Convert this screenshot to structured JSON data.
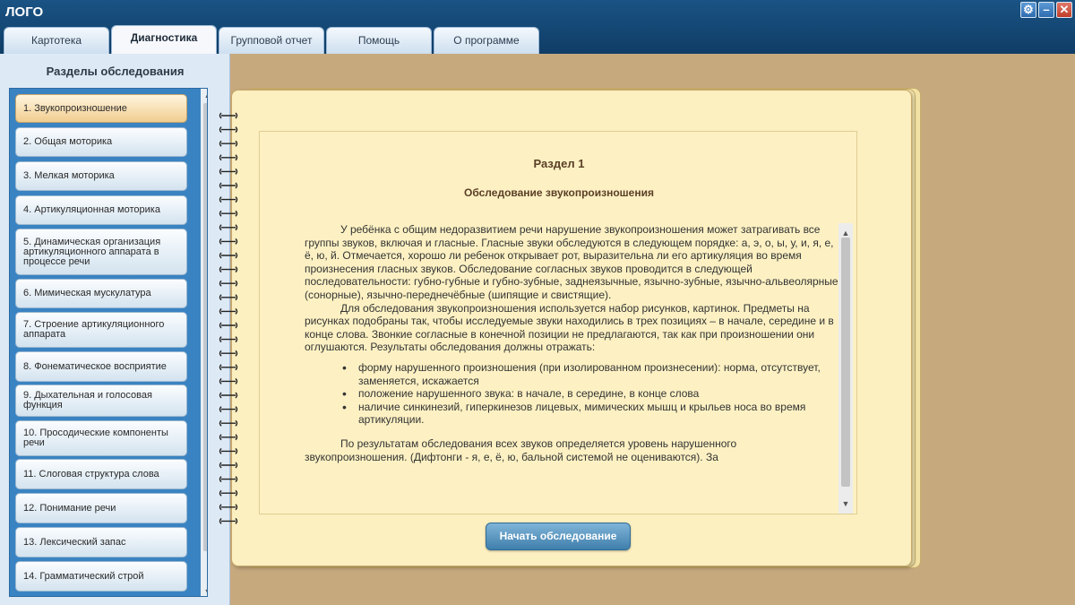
{
  "app": {
    "title": "ЛОГО"
  },
  "window_controls": {
    "settings": "⚙",
    "minimize": "–",
    "close": "✕"
  },
  "tabs": [
    {
      "label": "Картотека",
      "active": false
    },
    {
      "label": "Диагностика",
      "active": true
    },
    {
      "label": "Групповой отчет",
      "active": false
    },
    {
      "label": "Помощь",
      "active": false
    },
    {
      "label": "О программе",
      "active": false
    }
  ],
  "sidebar": {
    "title": "Разделы обследования",
    "items": [
      {
        "label": "1. Звукопроизношение",
        "active": true
      },
      {
        "label": "2. Общая моторика",
        "active": false
      },
      {
        "label": "3. Мелкая моторика",
        "active": false
      },
      {
        "label": "4. Артикуляционная моторика",
        "active": false
      },
      {
        "label": "5. Динамическая организация артикуляционного аппарата в процессе речи",
        "active": false
      },
      {
        "label": "6. Мимическая мускулатура",
        "active": false
      },
      {
        "label": "7. Строение артикуляционного аппарата",
        "active": false
      },
      {
        "label": "8. Фонематическое восприятие",
        "active": false
      },
      {
        "label": "9. Дыхательная и голосовая функция",
        "active": false
      },
      {
        "label": "10. Просодические компоненты речи",
        "active": false
      },
      {
        "label": "11. Слоговая структура слова",
        "active": false
      },
      {
        "label": "12. Понимание речи",
        "active": false
      },
      {
        "label": "13. Лексический запас",
        "active": false
      },
      {
        "label": "14. Грамматический строй",
        "active": false
      }
    ]
  },
  "content": {
    "section_label": "Раздел 1",
    "section_title": "Обследование звукопроизношения",
    "paragraph1": "У ребёнка с общим недоразвитием речи нарушение звукопроизношения может затрагивать все группы звуков, включая и гласные. Гласные звуки обследуются в следующем порядке: а, э, о, ы, у, и, я, е, ё, ю, й. Отмечается, хорошо ли ребенок открывает рот, выразительна ли его артикуляция во время произнесения гласных звуков. Обследование согласных звуков проводится в следующей последовательности: губно-губные и губно-зубные, заднеязычные, язычно-зубные, язычно-альвеолярные (сонорные), язычно-переднечёбные (шипящие и свистящие).",
    "paragraph2": "Для обследования звукопроизношения используется набор рисунков, картинок. Предметы на рисунках подобраны так, чтобы исследуемые звуки находились в трех позициях – в начале, середине и в конце слова. Звонкие согласные в конечной позиции не предлагаются, так как при произношении они оглушаются. Результаты обследования должны отражать:",
    "bullets": [
      "форму нарушенного произношения (при изолированном произнесении): норма, отсутствует, заменяется, искажается",
      "положение нарушенного звука: в начале, в середине, в конце слова",
      "наличие синкинезий, гиперкинезов лицевых, мимических мышц и крыльев носа во время артикуляции."
    ],
    "paragraph3": "По результатам обследования всех звуков определяется уровень нарушенного звукопроизношения. (Дифтонги - я, е, ё, ю, бальной системой не оцениваются). За"
  },
  "start_button": {
    "label": "Начать обследование"
  },
  "colors": {
    "topbar": "#0f3d66",
    "background": "#c7a97e",
    "notebook": "#fcefc0",
    "active_item": "#f1cd8f",
    "button": "#3f7fac"
  }
}
